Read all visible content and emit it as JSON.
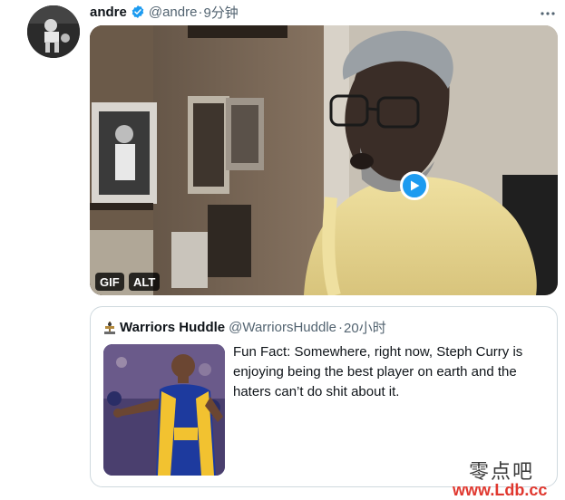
{
  "tweet": {
    "author_name": "andre",
    "handle": "@andre",
    "separator": "·",
    "time": "9分钟",
    "more_icon": "more-icon",
    "media": {
      "badge_gif": "GIF",
      "badge_alt": "ALT",
      "play_icon": "play-icon"
    }
  },
  "quote": {
    "author_name": "Warriors Huddle",
    "handle": "@WarriorsHuddle",
    "separator": "·",
    "time": "20小时",
    "text": "Fun Fact: Somewhere, right now, Steph Curry is enjoying being the best player on earth and the haters can’t do shit about it."
  },
  "watermark": {
    "cn": "零点吧",
    "url": "www.Ldb.cc"
  },
  "colors": {
    "accent": "#1d9bf0",
    "secondary_text": "#536471",
    "border": "#cfd9de",
    "watermark_red": "#e0382f"
  }
}
